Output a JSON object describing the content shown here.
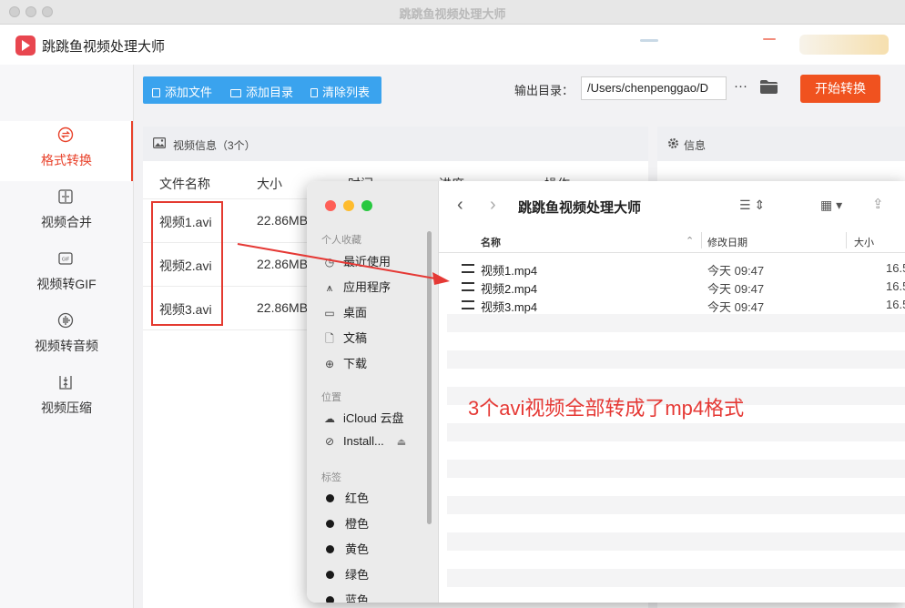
{
  "window": {
    "title": "跳跳鱼视频处理大师"
  },
  "header": {
    "app_name": "跳跳鱼视频处理大师"
  },
  "sidebar": {
    "items": [
      {
        "label": "格式转换",
        "icon": "convert-icon",
        "active": true
      },
      {
        "label": "视频合并",
        "icon": "merge-icon"
      },
      {
        "label": "视频转GIF",
        "icon": "gif-icon"
      },
      {
        "label": "视频转音频",
        "icon": "audio-icon"
      },
      {
        "label": "视频压缩",
        "icon": "compress-icon"
      }
    ]
  },
  "toolbar": {
    "add_file": "添加文件",
    "add_dir": "添加目录",
    "clear_list": "清除列表",
    "output_label": "输出目录：",
    "output_path": "/Users/chenpenggao/D",
    "more": "···",
    "start": "开始转换"
  },
  "video_panel": {
    "title": "视频信息（3个）",
    "columns": [
      "文件名称",
      "大小",
      "时间",
      "进度",
      "操作"
    ],
    "rows": [
      {
        "name": "视频1.avi",
        "size": "22.86MB"
      },
      {
        "name": "视频2.avi",
        "size": "22.86MB"
      },
      {
        "name": "视频3.avi",
        "size": "22.86MB"
      }
    ]
  },
  "info_panel": {
    "title": "信息"
  },
  "finder": {
    "title": "跳跳鱼视频处理大师",
    "sections": {
      "favorites": "个人收藏",
      "locations": "位置",
      "tags": "标签"
    },
    "favorites": [
      "最近使用",
      "应用程序",
      "桌面",
      "文稿",
      "下载"
    ],
    "locations": [
      "iCloud 云盘",
      "Install..."
    ],
    "tags": [
      "红色",
      "橙色",
      "黄色",
      "绿色",
      "蓝色"
    ],
    "columns": {
      "name": "名称",
      "date": "修改日期",
      "size": "大小"
    },
    "files": [
      {
        "name": "视频1.mp4",
        "date": "今天 09:47",
        "size": "16.5"
      },
      {
        "name": "视频2.mp4",
        "date": "今天 09:47",
        "size": "16.5"
      },
      {
        "name": "视频3.mp4",
        "date": "今天 09:47",
        "size": "16.5"
      }
    ]
  },
  "annotation": "3个avi视频全部转成了mp4格式",
  "colors": {
    "accent": "#f0521f",
    "toolbar_blue": "#3aa3ee",
    "annotation_red": "#e53935"
  }
}
